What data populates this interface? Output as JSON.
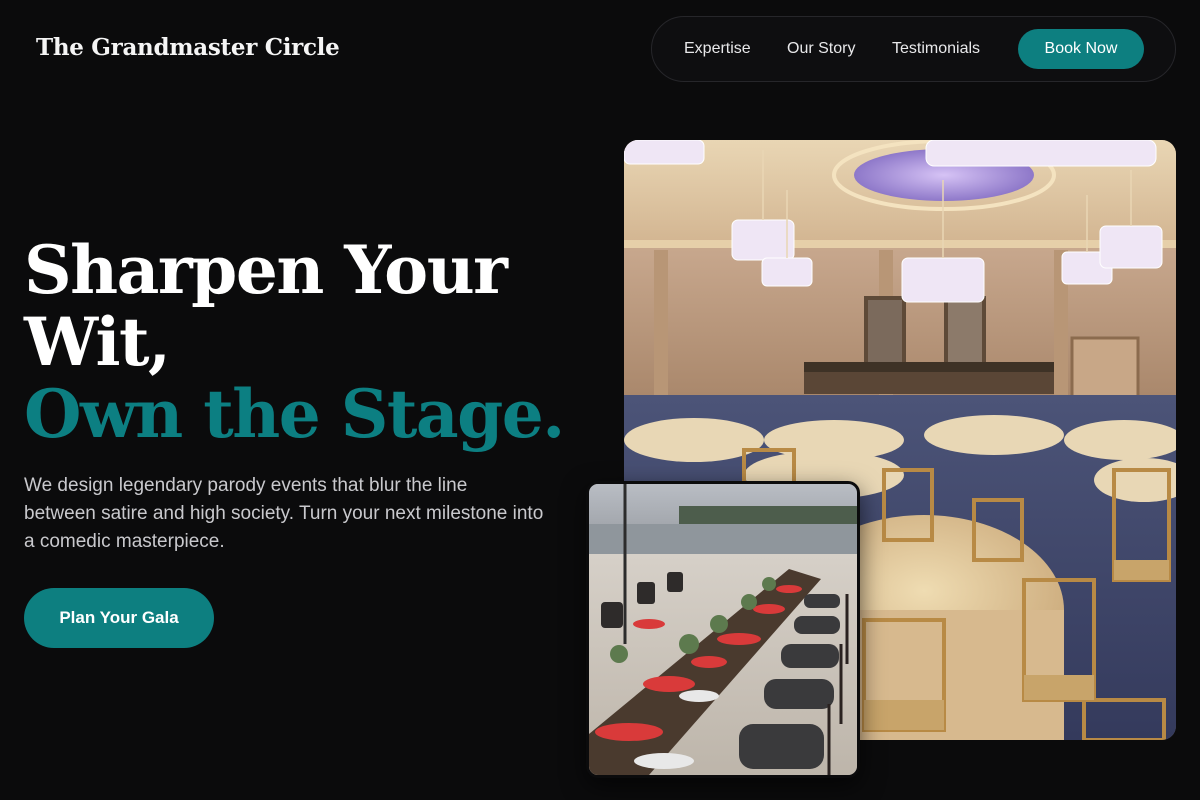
{
  "brand": {
    "name": "The Grandmaster Circle"
  },
  "nav": {
    "links": [
      "Expertise",
      "Our Story",
      "Testimonials"
    ],
    "book_label": "Book Now"
  },
  "hero": {
    "title_line1": "Sharpen Your",
    "title_line2": "Wit,",
    "title_accent": "Own the Stage.",
    "description": "We design legendary parody events that blur the line between satire and high society. Turn your next milestone into a comedic masterpiece.",
    "cta_label": "Plan Your Gala"
  },
  "colors": {
    "background": "#0b0b0c",
    "accent": "#0d7f80",
    "text": "#ffffff",
    "muted_text": "#c9c9cd"
  },
  "images": {
    "main": "ballroom-photo",
    "secondary": "beach-dinner-table-photo"
  }
}
